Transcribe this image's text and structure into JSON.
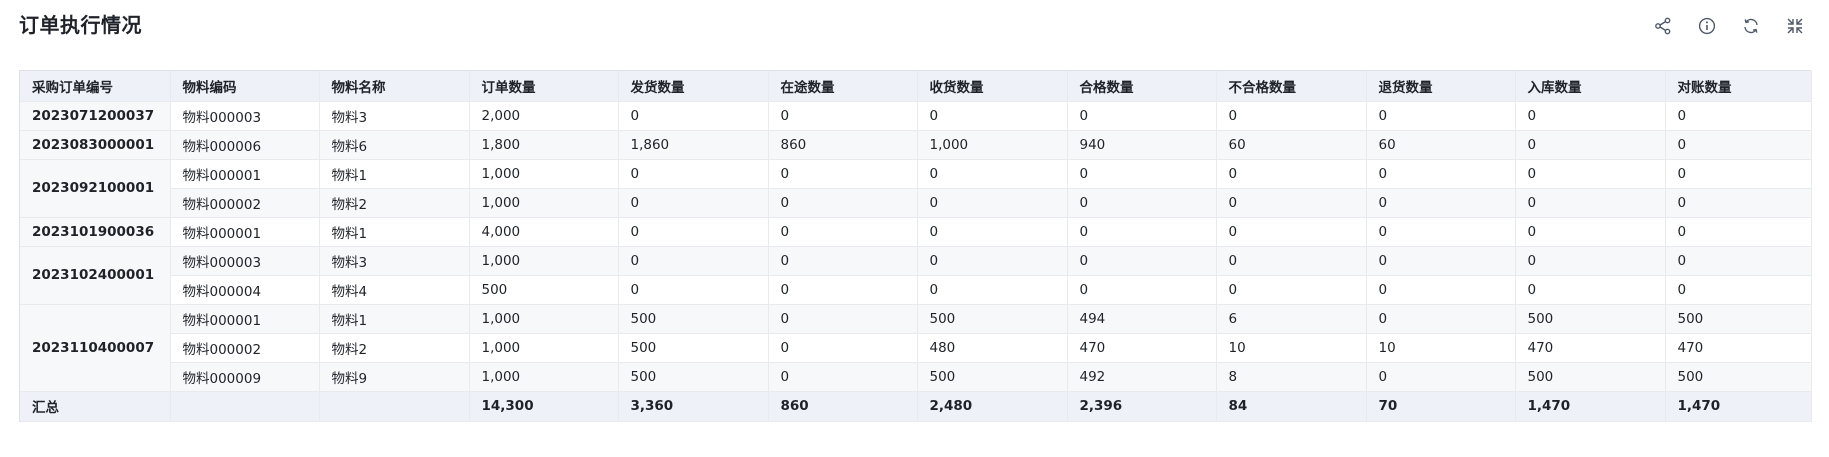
{
  "header": {
    "title": "订单执行情况"
  },
  "toolbar": {
    "share_icon": "share-icon",
    "info_icon": "info-icon",
    "refresh_icon": "refresh-icon",
    "collapse_icon": "collapse-icon"
  },
  "table": {
    "columns": [
      "采购订单编号",
      "物料编码",
      "物料名称",
      "订单数量",
      "发货数量",
      "在途数量",
      "收货数量",
      "合格数量",
      "不合格数量",
      "退货数量",
      "入库数量",
      "对账数量"
    ],
    "orders": [
      {
        "order_no": "2023071200037",
        "rows": [
          {
            "code": "物料000003",
            "name": "物料3",
            "vals": [
              "2,000",
              "0",
              "0",
              "0",
              "0",
              "0",
              "0",
              "0",
              "0"
            ]
          }
        ]
      },
      {
        "order_no": "2023083000001",
        "rows": [
          {
            "code": "物料000006",
            "name": "物料6",
            "vals": [
              "1,800",
              "1,860",
              "860",
              "1,000",
              "940",
              "60",
              "60",
              "0",
              "0"
            ]
          }
        ]
      },
      {
        "order_no": "2023092100001",
        "rows": [
          {
            "code": "物料000001",
            "name": "物料1",
            "vals": [
              "1,000",
              "0",
              "0",
              "0",
              "0",
              "0",
              "0",
              "0",
              "0"
            ]
          },
          {
            "code": "物料000002",
            "name": "物料2",
            "vals": [
              "1,000",
              "0",
              "0",
              "0",
              "0",
              "0",
              "0",
              "0",
              "0"
            ]
          }
        ]
      },
      {
        "order_no": "2023101900036",
        "rows": [
          {
            "code": "物料000001",
            "name": "物料1",
            "vals": [
              "4,000",
              "0",
              "0",
              "0",
              "0",
              "0",
              "0",
              "0",
              "0"
            ]
          }
        ]
      },
      {
        "order_no": "2023102400001",
        "rows": [
          {
            "code": "物料000003",
            "name": "物料3",
            "vals": [
              "1,000",
              "0",
              "0",
              "0",
              "0",
              "0",
              "0",
              "0",
              "0"
            ]
          },
          {
            "code": "物料000004",
            "name": "物料4",
            "vals": [
              "500",
              "0",
              "0",
              "0",
              "0",
              "0",
              "0",
              "0",
              "0"
            ]
          }
        ]
      },
      {
        "order_no": "2023110400007",
        "rows": [
          {
            "code": "物料000001",
            "name": "物料1",
            "vals": [
              "1,000",
              "500",
              "0",
              "500",
              "494",
              "6",
              "0",
              "500",
              "500"
            ]
          },
          {
            "code": "物料000002",
            "name": "物料2",
            "vals": [
              "1,000",
              "500",
              "0",
              "480",
              "470",
              "10",
              "10",
              "470",
              "470"
            ]
          },
          {
            "code": "物料000009",
            "name": "物料9",
            "vals": [
              "1,000",
              "500",
              "0",
              "500",
              "492",
              "8",
              "0",
              "500",
              "500"
            ]
          }
        ]
      }
    ],
    "total": {
      "label": "汇总",
      "vals": [
        "14,300",
        "3,360",
        "860",
        "2,480",
        "2,396",
        "84",
        "70",
        "1,470",
        "1,470"
      ]
    }
  }
}
